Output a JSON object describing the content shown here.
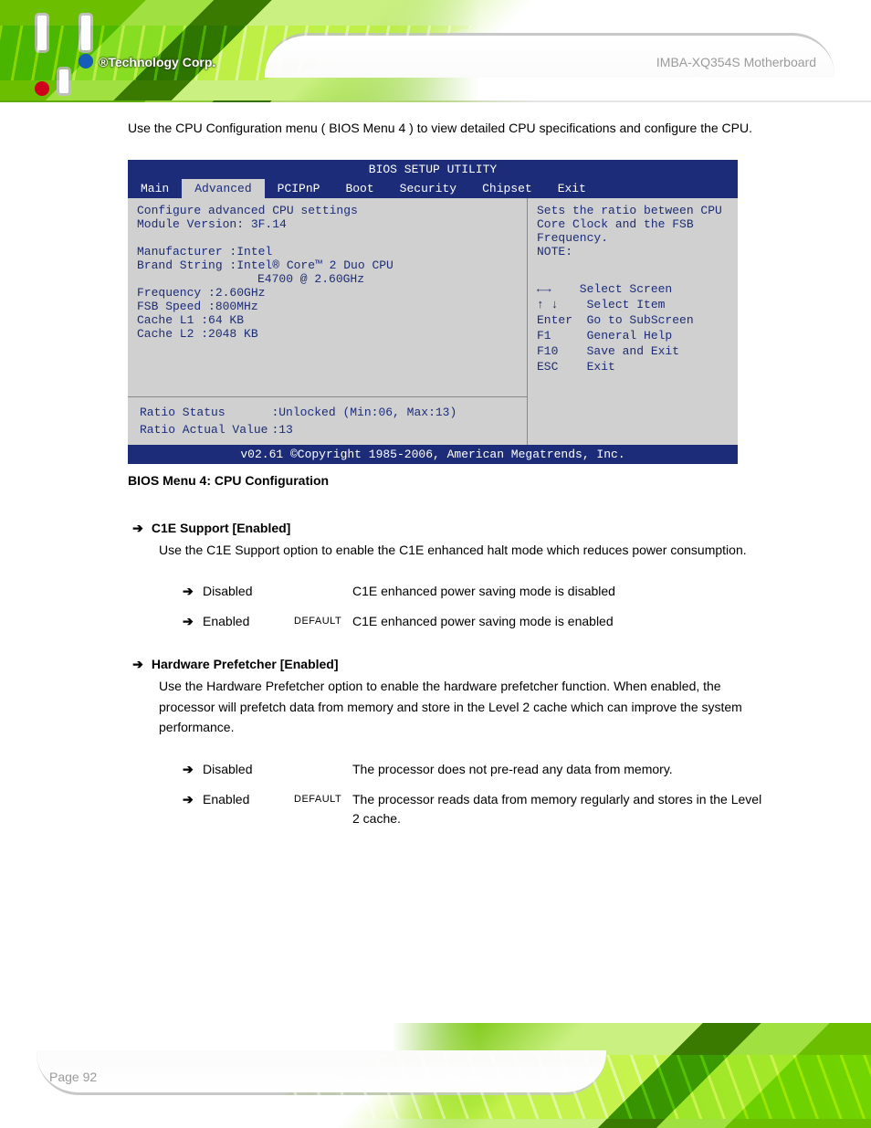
{
  "header": {
    "tagline": "®Technology Corp.",
    "doc_title": "IMBA-XQ354S Motherboard"
  },
  "intro": "Use the  CPU Configuration  menu ( BIOS Menu 4 ) to view detailed CPU specifications and configure the CPU.",
  "bios": {
    "title": "BIOS SETUP UTILITY",
    "tabs": {
      "main": "Main",
      "advanced": "Advanced",
      "pcipnp": "PCIPnP",
      "boot": "Boot",
      "security": "Security",
      "chipset": "Chipset",
      "exit": "Exit"
    },
    "section": "Configure advanced CPU settings",
    "module": "Module Version: 3F.14",
    "mfr": "Manufacturer     :Intel",
    "brand": "Brand String     :Intel® Core™ 2 Duo CPU",
    "brand2": "E4700 @ 2.60GHz",
    "freq": "Frequency        :2.60GHz",
    "fsb": "FSB Speed        :800MHz",
    "cache1": "Cache L1         :64 KB",
    "cache2": "Cache L2         :2048 KB",
    "ratio_status_l": "Ratio Status",
    "ratio_status_v": ":Unlocked (Min:06, Max:13)",
    "ratio_actual_l": "Ratio Actual Value",
    "ratio_actual_v": ":13",
    "help_hint": "Sets the ratio between CPU Core Clock and the FSB Frequency.",
    "help_note": "NOTE:",
    "keys": {
      "lr": "←→    Select Screen",
      "ud": "↑ ↓    Select Item",
      "enter": "Enter  Go to SubScreen",
      "f1": "F1     General Help",
      "f10": "F10    Save and Exit",
      "esc": "ESC    Exit"
    },
    "footer": "v02.61 ©Copyright 1985-2006, American Megatrends, Inc."
  },
  "caption": "BIOS Menu 4: CPU Configuration",
  "opt1": {
    "label": "C1E Support [Enabled]",
    "body": "Use the  C1E Support  option to enable the C1E enhanced halt mode which reduces power consumption.",
    "disabled_val": "Disabled",
    "disabled_desc": "C1E enhanced power saving mode is disabled",
    "enabled_val": "Enabled",
    "enabled_tag": "DEFAULT",
    "enabled_desc": "C1E enhanced power saving mode is enabled"
  },
  "opt2": {
    "label": "Hardware Prefetcher [Enabled]",
    "body": "Use the  Hardware Prefetcher  option to enable the hardware prefetcher function. When enabled, the processor will prefetch data from memory and store in the Level 2 cache which can improve the system performance.",
    "disabled_val": "Disabled",
    "disabled_desc": "The processor does not pre-read any data from memory.",
    "enabled_val": "Enabled",
    "enabled_tag": "DEFAULT",
    "enabled_desc": "The processor reads data from memory regularly and stores in the Level 2 cache."
  },
  "footer": {
    "page": "Page 92"
  }
}
